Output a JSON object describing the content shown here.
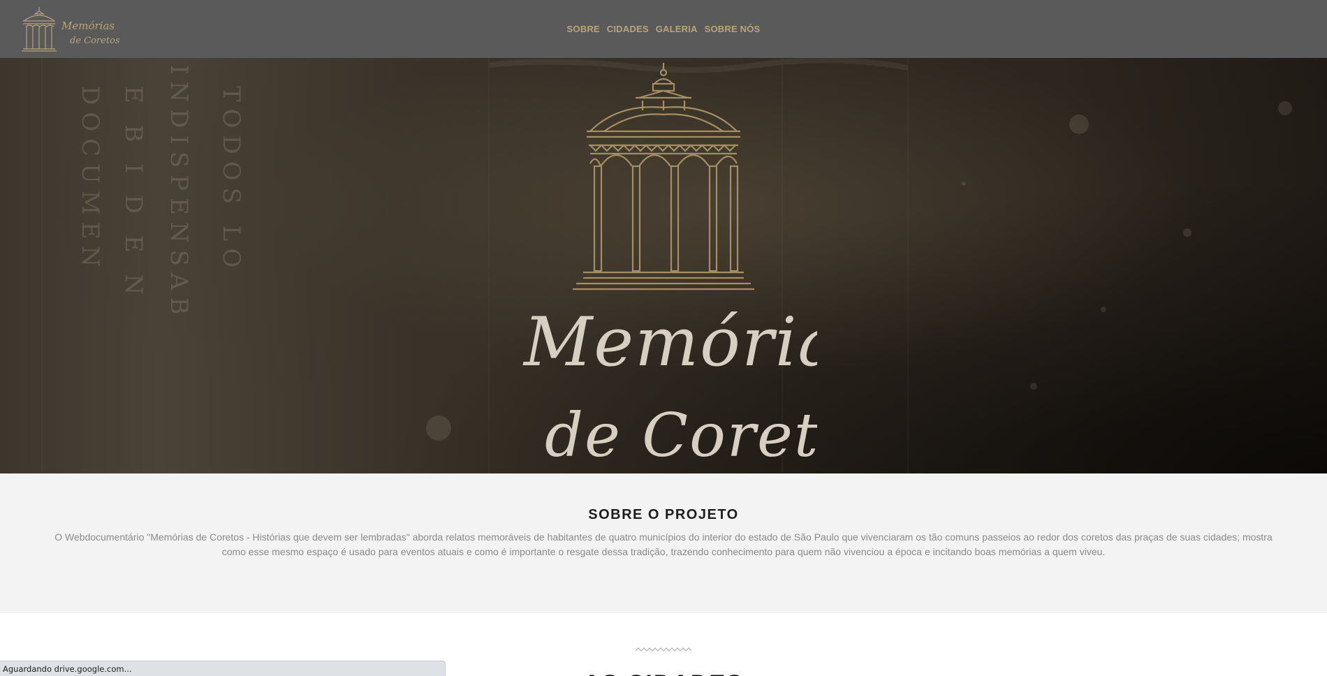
{
  "brand": {
    "logo_text_line1": "Memórias",
    "logo_text_line2": "de Coretos",
    "gold_color": "#b8a57a"
  },
  "nav": {
    "items": [
      {
        "label": "SOBRE"
      },
      {
        "label": "CIDADES"
      },
      {
        "label": "GALERIA"
      },
      {
        "label": "SOBRE NÓS"
      }
    ]
  },
  "hero": {
    "title_line1": "Memórias",
    "title_line2": "de Coretos",
    "emblem_icon": "gazebo-icon"
  },
  "about": {
    "title": "SOBRE O PROJETO",
    "text": "O Webdocumentário \"Memórias de Coretos - Histórias que devem ser lembradas\" aborda relatos memoráveis de habitantes de quatro municípios do interior do estado de São Paulo que vivenciaram os tão comuns passeios ao redor dos coretos das praças de suas cidades; mostra como esse mesmo espaço é usado para eventos atuais e como é importante o resgate dessa tradição, trazendo conhecimento para quem não vivenciou a época e incitando boas memórias a quem viveu."
  },
  "cities": {
    "title": "AS CIDADES"
  },
  "status_bar": {
    "text": "Aguardando drive.google.com..."
  }
}
